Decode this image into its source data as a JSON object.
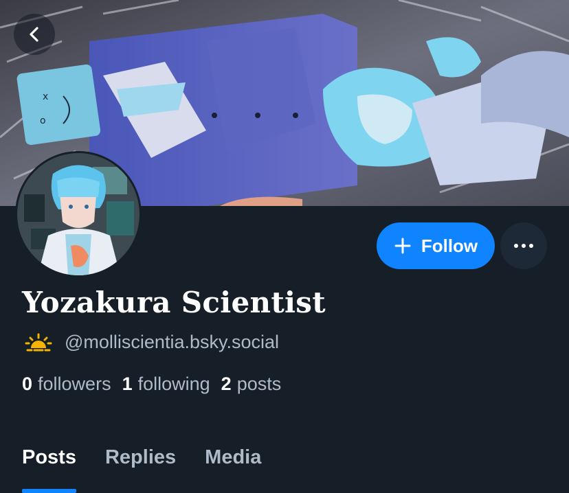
{
  "profile": {
    "display_name": "Yozakura Scientist",
    "handle": "@molliscientia.bsky.social",
    "handle_icon": "sunrise-icon",
    "banner_image": "anime-style illustration banner",
    "avatar_image": "anime-style avatar"
  },
  "actions": {
    "follow_label": "Follow",
    "follow_icon": "plus-icon",
    "more_icon": "ellipsis-icon",
    "back_icon": "chevron-left-icon"
  },
  "stats": {
    "followers_count": "0",
    "followers_label": "followers",
    "following_count": "1",
    "following_label": "following",
    "posts_count": "2",
    "posts_label": "posts"
  },
  "tabs": [
    {
      "label": "Posts",
      "active": true
    },
    {
      "label": "Replies",
      "active": false
    },
    {
      "label": "Media",
      "active": false
    }
  ],
  "colors": {
    "background": "#161e27",
    "accent": "#1083fe",
    "muted_text": "#aebbc9",
    "sun_icon": "#f5b400"
  }
}
